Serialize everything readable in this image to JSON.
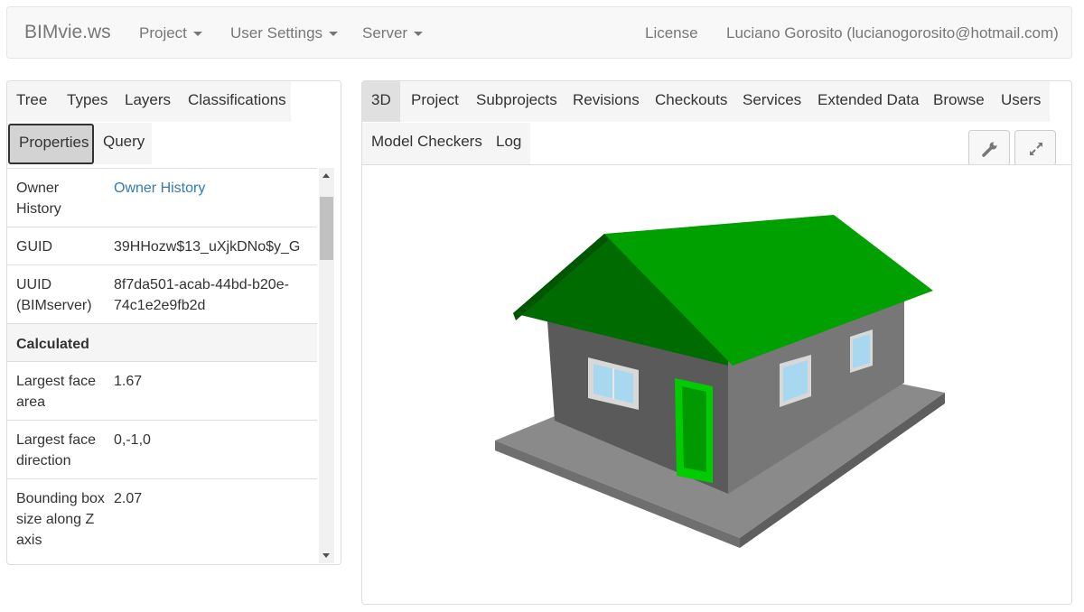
{
  "navbar": {
    "brand": "BIMvie.ws",
    "menus": [
      "Project",
      "User Settings",
      "Server"
    ],
    "license": "License",
    "user": "Luciano Gorosito (lucianogorosito@hotmail.com)"
  },
  "left_tabs": [
    "Tree",
    "Types",
    "Layers",
    "Classifications",
    "Properties",
    "Query"
  ],
  "properties": {
    "rows": [
      {
        "key": "Owner History",
        "value": "Owner History"
      },
      {
        "key": "GUID",
        "value": "39HHozw$13_uXjkDNo$y_G"
      },
      {
        "key": "UUID (BIMserver)",
        "value": "8f7da501-acab-44bd-b20e-74c1e2e9fb2d"
      },
      {
        "key": "Calculated",
        "value": ""
      },
      {
        "key": "Largest face area",
        "value": "1.67"
      },
      {
        "key": "Largest face direction",
        "value": "0,-1,0"
      },
      {
        "key": "Bounding box size along Z axis",
        "value": "2.07"
      }
    ]
  },
  "right_tabs": [
    "3D",
    "Project",
    "Subprojects",
    "Revisions",
    "Checkouts",
    "Services",
    "Extended Data",
    "Browse",
    "Users",
    "Model Checkers",
    "Log"
  ],
  "toolbar": {
    "settings_icon": "wrench-icon",
    "fullscreen_icon": "expand-icon"
  },
  "colors": {
    "roof": "#00a000",
    "door": "#00cc00",
    "walls": "#5a5a5a",
    "slab": "#8a8a8a",
    "link": "#337ab7"
  }
}
